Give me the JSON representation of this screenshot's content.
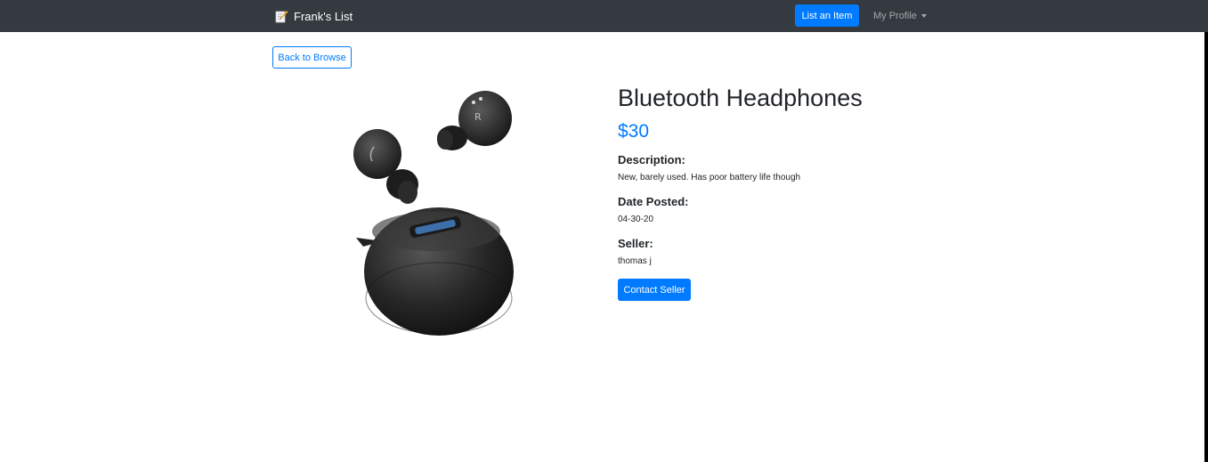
{
  "navbar": {
    "brand_label": "Frank's List",
    "brand_icon": "memo-icon",
    "list_item_label": "List an Item",
    "profile_label": "My Profile"
  },
  "back_button_label": "Back to Browse",
  "product": {
    "image_alt": "earbuds-with-charging-case",
    "title": "Bluetooth Headphones",
    "price": "$30",
    "description_label": "Description:",
    "description": "New, barely used. Has poor battery life though",
    "date_label": "Date Posted:",
    "date": "04-30-20",
    "seller_label": "Seller:",
    "seller": "thomas j"
  },
  "contact_label": "Contact Seller",
  "colors": {
    "navbar_bg": "#343a40",
    "primary": "#007bff"
  }
}
